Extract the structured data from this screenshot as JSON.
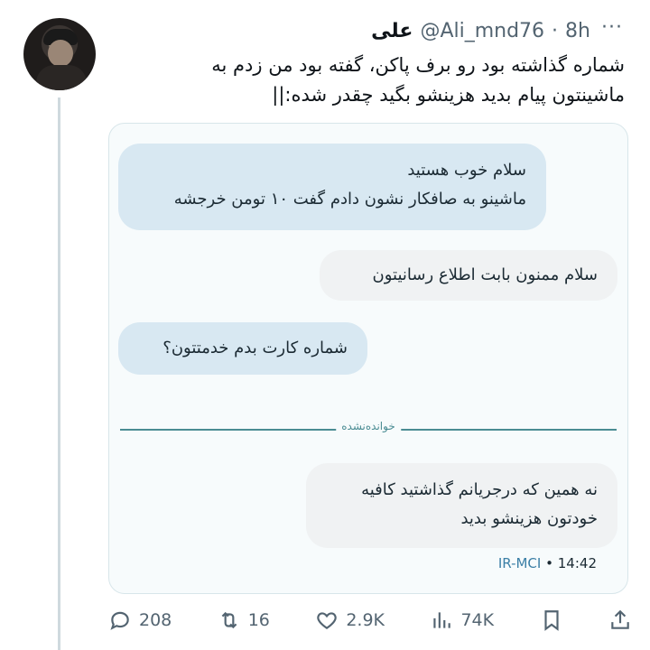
{
  "tweet": {
    "author_name": "علی",
    "handle": "@Ali_mnd76",
    "separator": "·",
    "time": "8h",
    "more": "···",
    "text_line1": "شماره گذاشته بود رو برف پاکن، گفته بود من زدم به",
    "text_line2": "ماشینتون پیام بدید هزینشو بگید چقدر شده:||"
  },
  "chat": {
    "bubble1_line1": "سلام خوب هستید",
    "bubble1_line2": "ماشینو به صافکار نشون دادم گفت ۱۰ تومن خرجشه",
    "bubble2": "سلام ممنون بابت اطلاع رسانیتون",
    "bubble3": "شماره کارت بدم خدمتتون؟",
    "unread_label": "خوانده‌نشده",
    "bubble4_line1": "نه همین که درجریانم گذاشتید کافیه",
    "bubble4_line2": "خودتون هزینشو بدید",
    "operator": "IR-MCI",
    "sep": "•",
    "time": "14:42"
  },
  "actions": {
    "replies": "208",
    "retweets": "16",
    "likes": "2.9K",
    "views": "74K"
  }
}
